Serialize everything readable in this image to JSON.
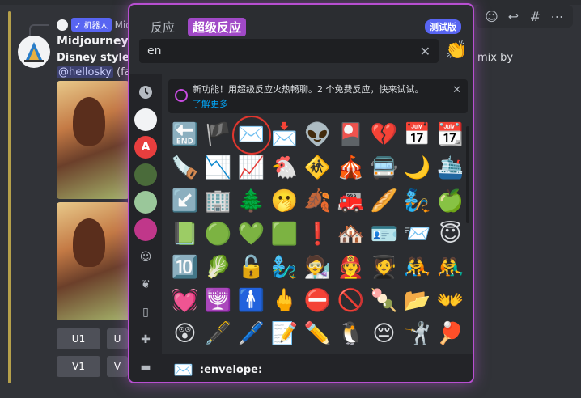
{
  "chat": {
    "reply_badge": "✓ 机器人",
    "reply_name": "Mid",
    "bot_name": "Midjourney Bot",
    "line2": "Disney style of",
    "mention": "@hellosky",
    "mention_tail": "(fas",
    "mix_by": "mix by",
    "buttons": [
      "U1",
      "U",
      "V1",
      "V"
    ]
  },
  "picker": {
    "tabs": [
      "反应",
      "超级反应"
    ],
    "active_tab": "超级反应",
    "beta_label": "测试版",
    "search": {
      "value": "en",
      "placeholder": ""
    },
    "clear_icon": "✕",
    "banner": {
      "text": "新功能！用超级反应火热畅聊。2 个免费反应，快来试试。",
      "link": "了解更多"
    },
    "selected_emoji": "✉️",
    "footer_label": ":envelope:",
    "emojis": [
      "🔚",
      "🏴",
      "✉️",
      "📩",
      "👽",
      "🎴",
      "💔",
      "📅",
      "📆",
      "🪚",
      "📉",
      "📈",
      "🐔",
      "🚸",
      "🎪",
      "🚍",
      "🌙",
      "🛳️",
      "↙️",
      "🏢",
      "🌲",
      "🫢",
      "🍂",
      "🚒",
      "🥖",
      "🧞",
      "🍏",
      "📗",
      "🟢",
      "💚",
      "🟩",
      "❗",
      "🏘️",
      "🪪",
      "📨",
      "😇",
      "🔟",
      "🥬",
      "🔓",
      "🧞‍♂️",
      "🧑‍🔬",
      "🧑‍🚒",
      "🧑‍🎓",
      "🤼",
      "🤼‍♂️",
      "💓",
      "🕎",
      "🚹",
      "🖕",
      "⛔",
      "🚫",
      "🍡",
      "📂",
      "👐",
      "😲",
      "🖋️",
      "🖊️",
      "📝",
      "✏️",
      "🐧",
      "😔",
      "🤺",
      "🏓",
      "🍜"
    ],
    "sidebar_icons": [
      "clock-icon",
      "server-1",
      "server-2",
      "server-3",
      "server-4",
      "server-5",
      "smile-icon",
      "leaf-icon",
      "cup-icon",
      "gamepad-icon",
      "car-icon"
    ]
  },
  "accent": {
    "border": "#b84fd1",
    "tab_active": "#a149c7",
    "selection_ring": "#e0362e",
    "link": "#00a8fc"
  }
}
